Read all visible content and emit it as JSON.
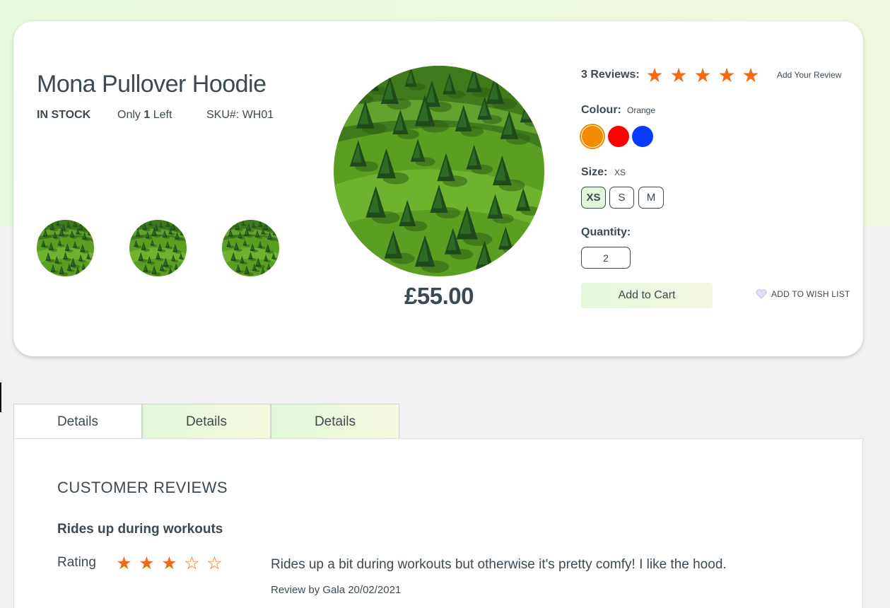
{
  "product": {
    "title": "Mona Pullover Hoodie",
    "stock_status": "IN STOCK",
    "stock_prefix": "Only ",
    "stock_count": "1",
    "stock_suffix": " Left",
    "sku": "SKU#: WH01",
    "price": "£55.00",
    "image_subject": "forest-hillside"
  },
  "reviews_summary": {
    "label": "3 Reviews:",
    "rating_stars": 5,
    "add_review_link": "Add Your Review"
  },
  "colour": {
    "label": "Colour:",
    "selected": "Orange",
    "swatches": [
      {
        "name": "orange",
        "hex": "#f38b00"
      },
      {
        "name": "red",
        "hex": "#ff0000"
      },
      {
        "name": "blue",
        "hex": "#0a3cff"
      }
    ]
  },
  "size": {
    "label": "Size:",
    "selected": "XS",
    "options": [
      "XS",
      "S",
      "M"
    ]
  },
  "quantity": {
    "label": "Quantity:",
    "value": "2"
  },
  "actions": {
    "add_to_cart": "Add to Cart",
    "wish_list": "ADD TO WISH LIST"
  },
  "tabs": [
    {
      "label": "Details",
      "active": true
    },
    {
      "label": "Details",
      "active": false
    },
    {
      "label": "Details",
      "active": false
    }
  ],
  "customer_reviews": {
    "heading": "CUSTOMER REVIEWS",
    "items": [
      {
        "title": "Rides up during workouts",
        "rating_label": "Rating",
        "rating": 3,
        "max_rating": 5,
        "text": "Rides up a bit during workouts but otherwise it's pretty comfy! I like the hood.",
        "byline": "Review by Gala 20/02/2021"
      }
    ]
  },
  "colors": {
    "star": "#f36b14",
    "accent_green": "#e3f6dc",
    "text": "#3d4a52"
  }
}
